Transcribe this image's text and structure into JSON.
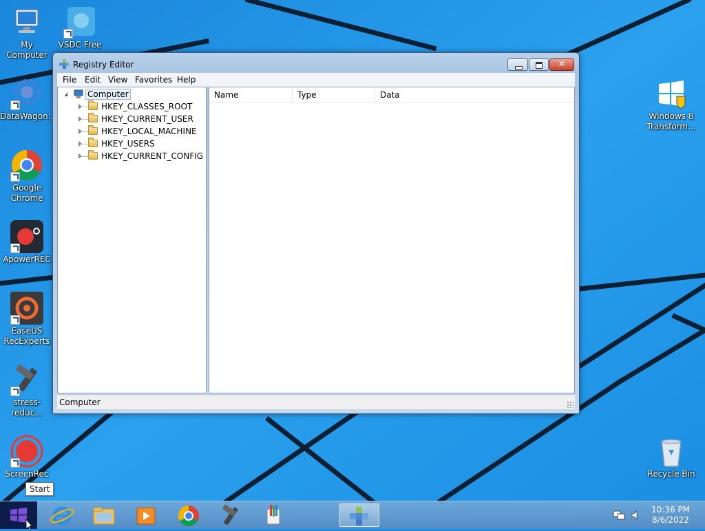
{
  "desktop": {
    "icons": [
      {
        "label": "My Computer"
      },
      {
        "label": "VSDC Free"
      },
      {
        "label": "DataWagon..."
      },
      {
        "label": "Google\nChrome"
      },
      {
        "label": "ApowerREC"
      },
      {
        "label": "EaseUS\nRecExperts"
      },
      {
        "label": "stress-reduc..."
      },
      {
        "label": "ScreenRec"
      },
      {
        "label": "Windows 8\nTransform..."
      },
      {
        "label": "Recycle Bin"
      }
    ]
  },
  "window": {
    "title": "Registry Editor",
    "menu": [
      "File",
      "Edit",
      "View",
      "Favorites",
      "Help"
    ],
    "tree": {
      "root": "Computer",
      "keys": [
        "HKEY_CLASSES_ROOT",
        "HKEY_CURRENT_USER",
        "HKEY_LOCAL_MACHINE",
        "HKEY_USERS",
        "HKEY_CURRENT_CONFIG"
      ]
    },
    "columns": [
      "Name",
      "Type",
      "Data"
    ],
    "status": "Computer"
  },
  "taskbar": {
    "tooltip": "Start",
    "time": "10:36 PM",
    "date": "8/6/2022",
    "pinned": [
      "internet-explorer",
      "file-explorer",
      "media-player",
      "google-chrome",
      "stress-reducer",
      "paint",
      "registry-editor"
    ]
  },
  "colors": {
    "accent": "#1e8fe0",
    "titlebar": "#b9d1ea",
    "close": "#c7412a"
  }
}
